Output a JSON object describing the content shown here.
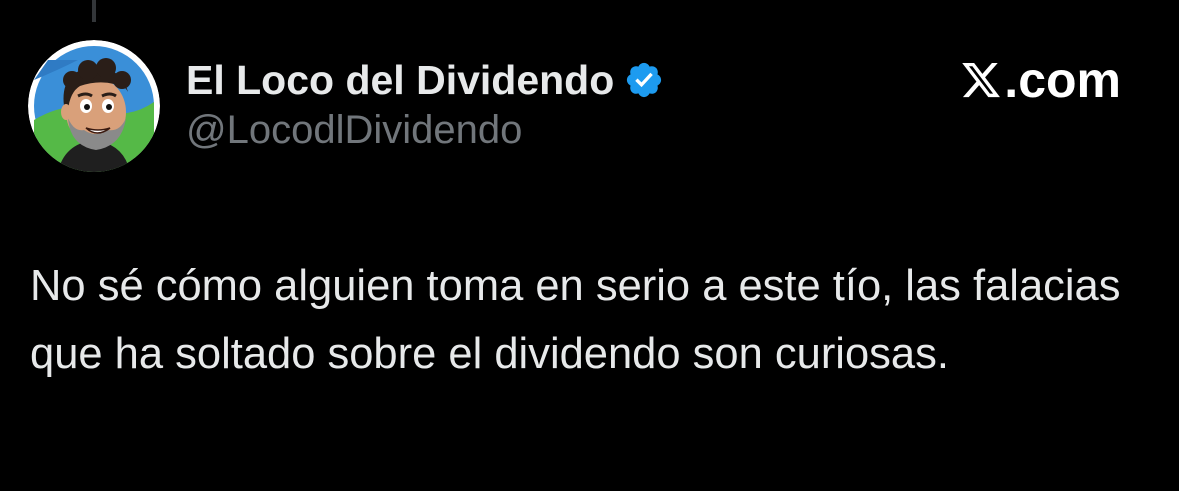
{
  "tweet": {
    "author": {
      "display_name": "El Loco del Dividendo",
      "handle": "@LocodlDividendo",
      "verified": true,
      "verified_icon": "verified-badge-icon",
      "avatar_icon": "cartoon-bearded-man-avatar"
    },
    "brand": {
      "icon": "x-logo-icon",
      "text": ".com"
    },
    "text": "No sé cómo alguien toma en serio a este tío, las falacias que ha soltado sobre el dividendo son curiosas."
  },
  "colors": {
    "background": "#000000",
    "primary_text": "#e7e9ea",
    "secondary_text": "#71767b",
    "verified_blue": "#1d9bf0",
    "brand_text": "#ffffff"
  }
}
